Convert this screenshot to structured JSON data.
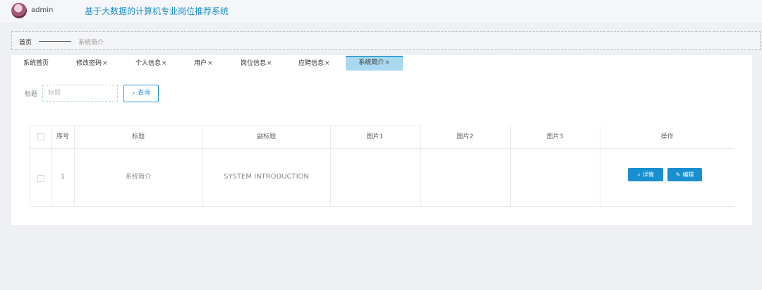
{
  "header": {
    "username": "admin",
    "system_title": "基于大数据的计算机专业岗位推荐系统"
  },
  "breadcrumb": {
    "home": "首页",
    "current": "系统简介"
  },
  "tabs": [
    {
      "label": "系统首页",
      "closable": false
    },
    {
      "label": "修改密码",
      "closable": true
    },
    {
      "label": "个人信息",
      "closable": true
    },
    {
      "label": "用户",
      "closable": true
    },
    {
      "label": "岗位信息",
      "closable": true
    },
    {
      "label": "应聘信息",
      "closable": true
    },
    {
      "label": "系统简介",
      "closable": true,
      "active": true
    }
  ],
  "close_glyph": "×",
  "search": {
    "label": "标题",
    "placeholder": "标题",
    "button_label": "查询",
    "button_icon": "search-icon"
  },
  "table": {
    "columns": [
      "序号",
      "标题",
      "副标题",
      "图片1",
      "图片2",
      "图片3",
      "操作"
    ],
    "rows": [
      {
        "index": "1",
        "title": "系统简介",
        "subtitle": "SYSTEM INTRODUCTION",
        "image1": "",
        "image2": "",
        "image3": ""
      }
    ],
    "actions": {
      "detail_label": "详情",
      "detail_icon": "search-icon",
      "edit_label": "编辑",
      "edit_icon": "pencil-icon"
    }
  },
  "colors": {
    "accent": "#1a8fd0",
    "active_tab": "#a9d9f1",
    "title": "#1e8fc6"
  }
}
